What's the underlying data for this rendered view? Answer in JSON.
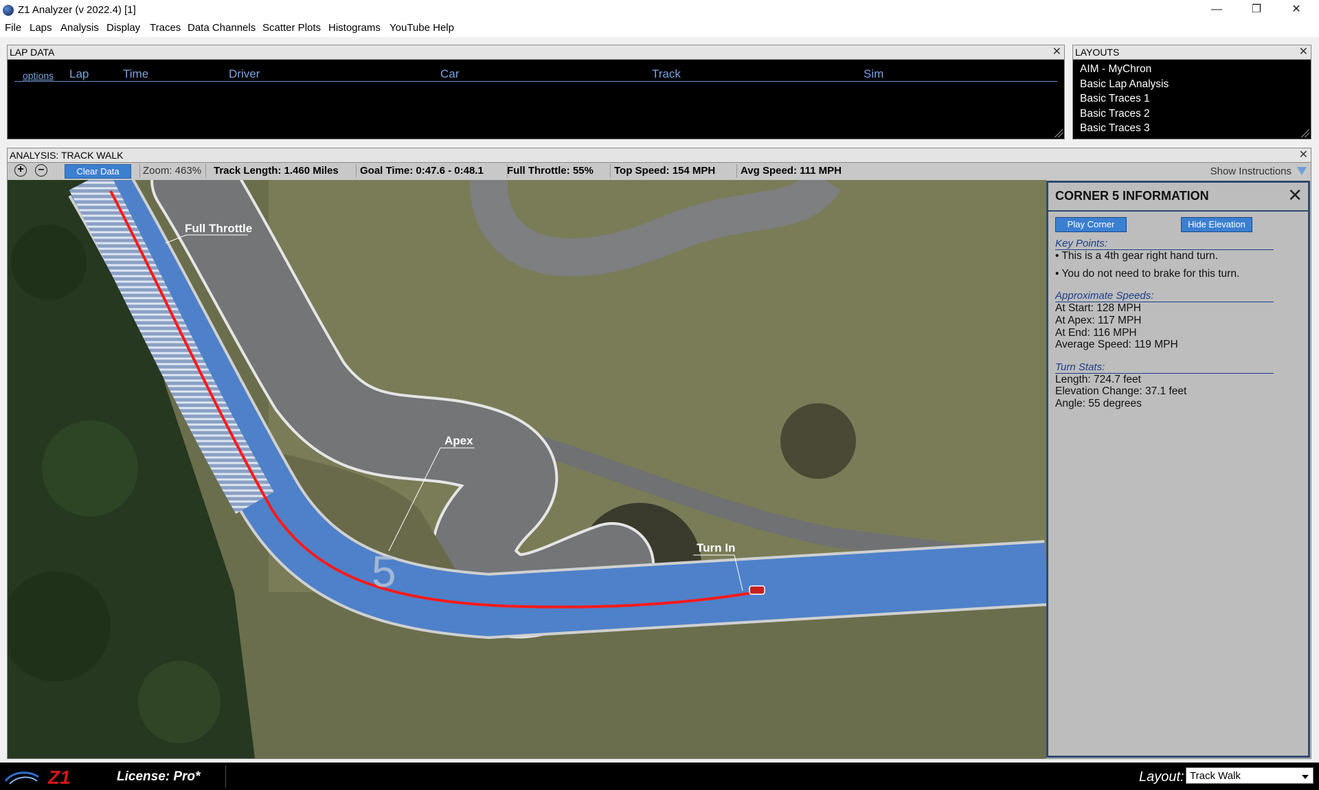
{
  "window": {
    "title": "Z1 Analyzer (v 2022.4) [1]",
    "minimize_icon": "minimize-icon",
    "maximize_icon": "restore-icon",
    "close_icon": "close-icon"
  },
  "menu": [
    "File",
    "Laps",
    "Analysis",
    "Display",
    "Traces",
    "Data Channels",
    "Scatter Plots",
    "Histograms",
    "YouTube Help"
  ],
  "lap_data": {
    "title": "LAP DATA",
    "options_label": "options",
    "columns": [
      "Lap",
      "Time",
      "Driver",
      "Car",
      "Track",
      "Sim"
    ],
    "rows": []
  },
  "layouts_panel": {
    "title": "LAYOUTS",
    "items": [
      "AIM - MyChron",
      "Basic Lap Analysis",
      "Basic Traces 1",
      "Basic Traces 2",
      "Basic Traces 3"
    ]
  },
  "analysis": {
    "title": "ANALYSIS: TRACK WALK",
    "clear_button": "Clear Data",
    "zoom": "Zoom: 463%",
    "track_length": "Track Length: 1.460 Miles",
    "goal_time": "Goal Time: 0:47.6 - 0:48.1",
    "full_throttle": "Full Throttle: 55%",
    "top_speed": "Top Speed: 154 MPH",
    "avg_speed": "Avg Speed: 111 MPH",
    "show_instructions": "Show Instructions"
  },
  "map": {
    "labels": {
      "full_throttle": "Full Throttle",
      "apex": "Apex",
      "turn_in": "Turn In",
      "corner_number": "5"
    },
    "colors": {
      "racing_line": "#ff1a1a",
      "track_overlay": "#3f78c8"
    }
  },
  "corner_info": {
    "title": "CORNER 5 INFORMATION",
    "play_button": "Play Corner",
    "hide_button": "Hide Elevation",
    "key_points_head": "Key Points:",
    "key_points": [
      "• This is a 4th gear right hand turn.",
      "• You do not need to brake for this turn."
    ],
    "speeds_head": "Approximate Speeds:",
    "speeds": [
      "At Start: 128 MPH",
      "At Apex: 117 MPH",
      "At End: 116 MPH",
      "Average Speed: 119 MPH"
    ],
    "stats_head": "Turn Stats:",
    "stats": [
      "Length: 724.7 feet",
      "Elevation Change: 37.1 feet",
      "Angle: 55 degrees"
    ]
  },
  "bottom": {
    "logo_text": "Z1",
    "license": "License: Pro*",
    "layout_label": "Layout:",
    "layout_value": "Track Walk"
  }
}
